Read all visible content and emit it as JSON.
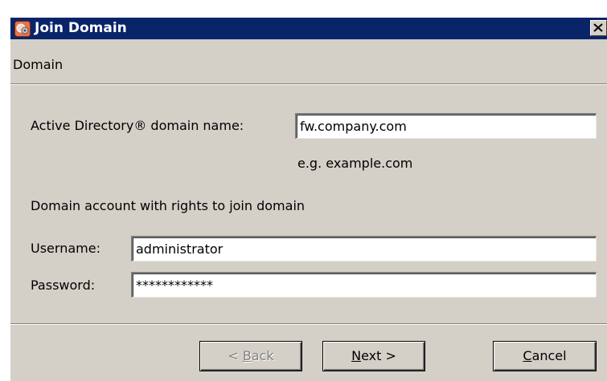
{
  "window": {
    "title": "Join Domain",
    "icon": "domain-app-icon",
    "close_icon": "close-icon"
  },
  "header": {
    "section": "Domain"
  },
  "form": {
    "domain_label": "Active Directory® domain name:",
    "domain_value": "fw.company.com",
    "domain_hint": "e.g. example.com",
    "account_heading": "Domain account with rights to join domain",
    "username_label": "Username:",
    "username_value": "administrator",
    "password_label": "Password:",
    "password_value": "************"
  },
  "buttons": {
    "back": {
      "prefix": "< ",
      "mnemonic": "B",
      "rest": "ack",
      "enabled": false
    },
    "next": {
      "mnemonic": "N",
      "rest": "ext >",
      "enabled": true
    },
    "cancel": {
      "mnemonic": "C",
      "rest": "ancel",
      "enabled": true
    }
  }
}
